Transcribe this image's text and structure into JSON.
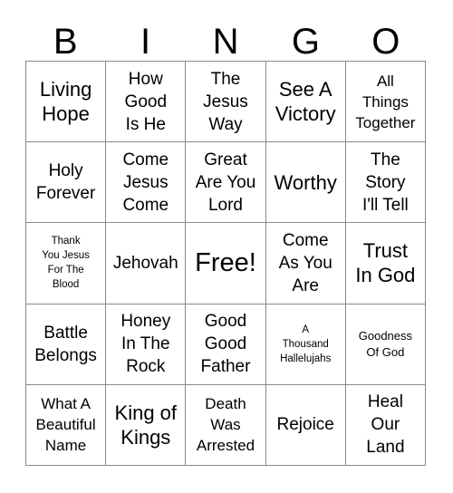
{
  "card": {
    "title_letters": [
      "B",
      "I",
      "N",
      "G",
      "O"
    ],
    "rows": [
      [
        {
          "text": "Living\nHope",
          "size": "fs-lg"
        },
        {
          "text": "How\nGood\nIs He",
          "size": "fs-md"
        },
        {
          "text": "The\nJesus\nWay",
          "size": "fs-md"
        },
        {
          "text": "See A\nVictory",
          "size": "fs-lg"
        },
        {
          "text": "All\nThings\nTogether",
          "size": "fs-sm"
        }
      ],
      [
        {
          "text": "Holy\nForever",
          "size": "fs-md"
        },
        {
          "text": "Come\nJesus\nCome",
          "size": "fs-md"
        },
        {
          "text": "Great\nAre You\nLord",
          "size": "fs-md"
        },
        {
          "text": "Worthy",
          "size": "fs-lg"
        },
        {
          "text": "The\nStory\nI'll Tell",
          "size": "fs-md"
        }
      ],
      [
        {
          "text": "Thank\nYou Jesus\nFor The\nBlood",
          "size": "fs-xxs"
        },
        {
          "text": "Jehovah",
          "size": "fs-md"
        },
        {
          "text": "Free!",
          "size": "fs-xl"
        },
        {
          "text": "Come\nAs You\nAre",
          "size": "fs-md"
        },
        {
          "text": "Trust\nIn God",
          "size": "fs-lg"
        }
      ],
      [
        {
          "text": "Battle\nBelongs",
          "size": "fs-md"
        },
        {
          "text": "Honey\nIn The\nRock",
          "size": "fs-md"
        },
        {
          "text": "Good\nGood\nFather",
          "size": "fs-md"
        },
        {
          "text": "A\nThousand\nHallelujahs",
          "size": "fs-xxs"
        },
        {
          "text": "Goodness\nOf God",
          "size": "fs-xs"
        }
      ],
      [
        {
          "text": "What A\nBeautiful\nName",
          "size": "fs-sm"
        },
        {
          "text": "King of\nKings",
          "size": "fs-lg"
        },
        {
          "text": "Death\nWas\nArrested",
          "size": "fs-sm"
        },
        {
          "text": "Rejoice",
          "size": "fs-md"
        },
        {
          "text": "Heal\nOur\nLand",
          "size": "fs-md"
        }
      ]
    ],
    "free_space": {
      "row": 2,
      "col": 2,
      "label": "Free!"
    },
    "colors": {
      "background": "#ffffff",
      "text": "#000000",
      "grid_line": "#8a8a8a"
    }
  }
}
